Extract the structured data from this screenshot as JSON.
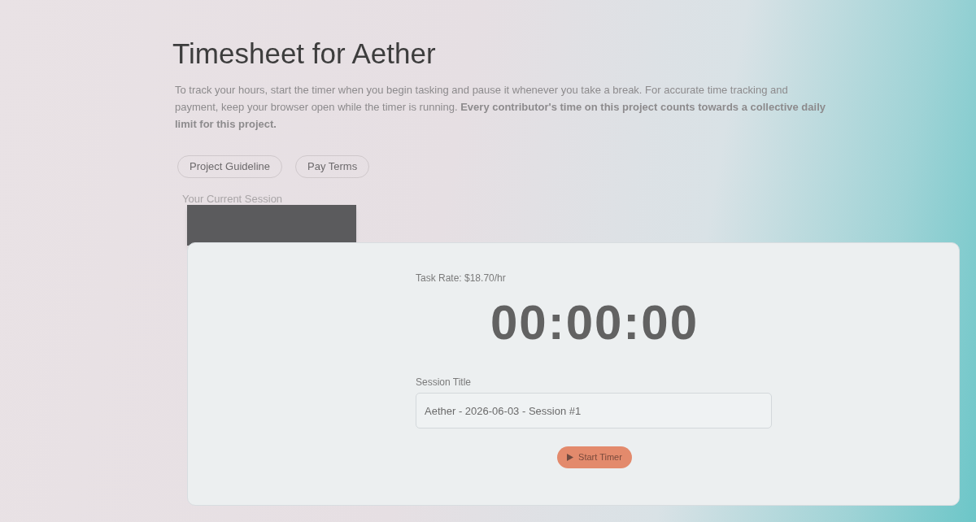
{
  "page": {
    "title": "Timesheet for Aether",
    "description": "To track your hours, start the timer when you begin tasking and pause it whenever you take a break. For accurate time tracking and payment, keep your browser open while the timer is running. **Every contributor's time on this project counts towards a collective daily limit for this project.**"
  },
  "links": [
    {
      "label": "Project Guideline"
    },
    {
      "label": "Pay Terms"
    }
  ],
  "session": {
    "heading": "Your Current Session"
  },
  "timer_card": {
    "task_rate": "Task Rate: $18.70/hr",
    "timer": "00:00:00",
    "session_title": {
      "label": "Session Title",
      "value": "Aether - 2026-06-03 - Session #1"
    },
    "start_button": {
      "label": "Start Timer"
    }
  }
}
